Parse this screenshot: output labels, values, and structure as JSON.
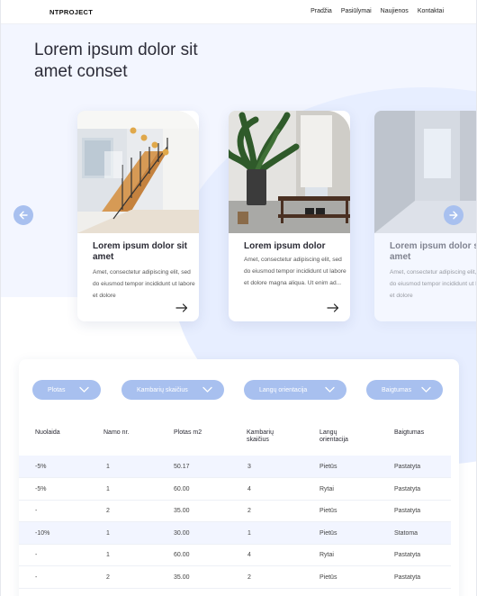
{
  "header": {
    "logo": "NTPROJECT",
    "nav": [
      "Pradžia",
      "Pasiūlymai",
      "Naujienos",
      "Kontaktai"
    ]
  },
  "hero": {
    "title": "Lorem ipsum dolor sit amet conset"
  },
  "cards": [
    {
      "title": "Lorem ipsum dolor sit amet",
      "text": "Amet, consectetur adipiscing elit, sed do eiusmod tempor incididunt ut labore et dolore",
      "image": "staircase-photo"
    },
    {
      "title": "Lorem ipsum dolor",
      "text": "Amet, consectetur adipiscing elit, sed do eiusmod tempor incididunt ut labore et dolore magna aliqua. Ut enim ad...",
      "image": "plant-interior-photo"
    },
    {
      "title": "Lorem ipsum dolor sit amet",
      "text": "Amet, consectetur adipiscing elit, sed do eiusmod tempor incididunt ut labore et dolore",
      "image": "concrete-interior-photo"
    }
  ],
  "filters": [
    "Plotas",
    "Kambarių skaičius",
    "Langų orientacija",
    "Baigtumas"
  ],
  "table": {
    "headers": [
      "Nuolaida",
      "Namo nr.",
      "Plotas m2",
      "Kambarių skaičius",
      "Langų orientacija",
      "Baigtumas"
    ],
    "rows": [
      [
        "-5%",
        "1",
        "50.17",
        "3",
        "Pietūs",
        "Pastatyta"
      ],
      [
        "-5%",
        "1",
        "60.00",
        "4",
        "Rytai",
        "Pastatyta"
      ],
      [
        "-",
        "2",
        "35.00",
        "2",
        "Pietūs",
        "Pastatyta"
      ],
      [
        "-10%",
        "1",
        "30.00",
        "1",
        "Pietūs",
        "Statoma"
      ],
      [
        "-",
        "1",
        "60.00",
        "4",
        "Rytai",
        "Pastatyta"
      ],
      [
        "-",
        "2",
        "35.00",
        "2",
        "Pietūs",
        "Pastatyta"
      ]
    ]
  },
  "colors": {
    "accent": "#a8c0ef",
    "hero_bg": "#f3f6ff",
    "row_highlight": "#f2f5ff"
  }
}
